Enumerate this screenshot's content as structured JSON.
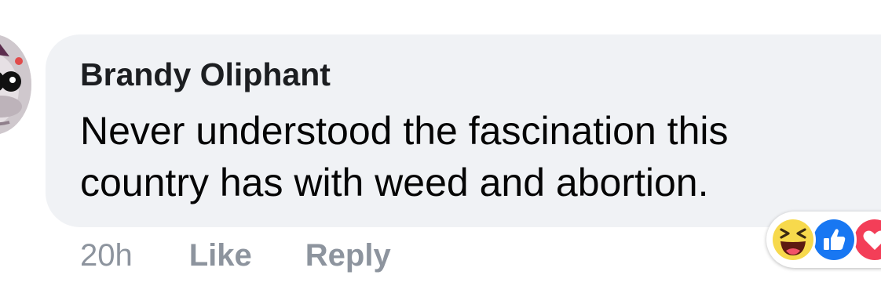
{
  "comment": {
    "author": "Brandy Oliphant",
    "text": "Never understood the fascination this country has with weed and abortion.",
    "time": "20h",
    "like_label": "Like",
    "reply_label": "Reply",
    "reactions": [
      "haha-reaction-icon",
      "like-reaction-icon",
      "love-reaction-icon"
    ]
  },
  "colors": {
    "bubble": "#f0f2f5",
    "author_text": "#1c1e21",
    "action_text": "#8d949e",
    "like_blue": "#1877f2",
    "love_red": "#f33e58",
    "haha_yellow": "#f7d94c"
  }
}
